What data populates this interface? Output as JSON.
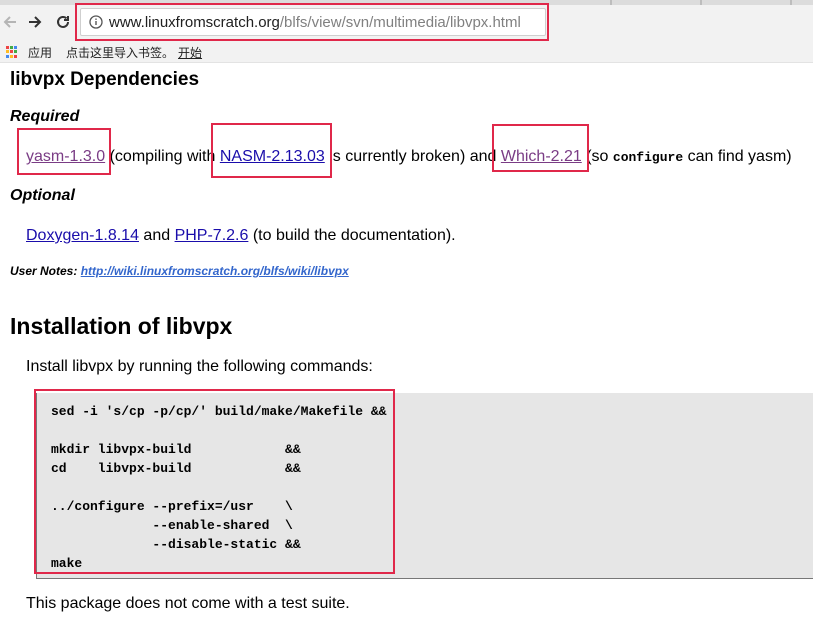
{
  "browser": {
    "url_host": "www.linuxfromscratch.org",
    "url_path": "/blfs/view/svn/multimedia/libvpx.html",
    "bookmarks": {
      "apps_label": "应用",
      "import_text": "点击这里导入书签。",
      "start_link": "开始"
    }
  },
  "page": {
    "dependencies_title": "libvpx Dependencies",
    "required_label": "Required",
    "required": {
      "yasm": "yasm-1.3.0",
      "t1": " (compiling with ",
      "nasm": "NASM-2.13.03",
      "t2": " is currently broken) and ",
      "which": "Which-2.21",
      "t3": " (so ",
      "configure": "configure",
      "t4": " can find yasm)"
    },
    "optional_label": "Optional",
    "optional": {
      "doxygen": "Doxygen-1.8.14",
      "t1": " and ",
      "php": "PHP-7.2.6",
      "t2": " (to build the documentation)."
    },
    "user_notes_label": "User Notes:",
    "user_notes_link": "http://wiki.linuxfromscratch.org/blfs/wiki/libvpx",
    "installation_title": "Installation of libvpx",
    "install_intro": "Install libvpx by running the following commands:",
    "code": "sed -i 's/cp -p/cp/' build/make/Makefile &&\n\nmkdir libvpx-build            &&\ncd    libvpx-build            &&\n\n../configure --prefix=/usr    \\\n             --enable-shared  \\\n             --disable-static &&\nmake",
    "test_note": "This package does not come with a test suite."
  },
  "colors": {
    "highlight": "#e0284a",
    "link": "#1a0dab",
    "visited": "#7a3c85"
  }
}
